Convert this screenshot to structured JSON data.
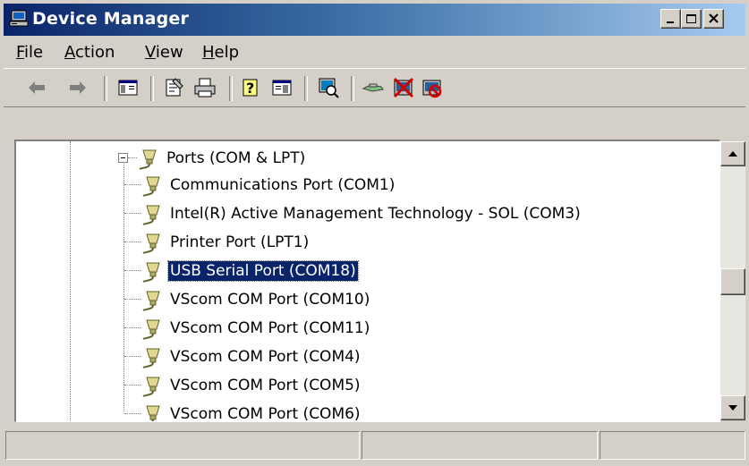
{
  "window": {
    "title": "Device Manager"
  },
  "menu": [
    {
      "label": "File",
      "mnemonic": "F",
      "rest": "ile"
    },
    {
      "label": "Action",
      "mnemonic": "A",
      "rest": "ction"
    },
    {
      "label": "View",
      "mnemonic": "V",
      "rest": "iew"
    },
    {
      "label": "Help",
      "mnemonic": "H",
      "rest": "elp"
    }
  ],
  "toolbar": {
    "buttons": [
      "back-icon",
      "forward-icon",
      "show-hide-console-tree-icon",
      "properties-icon",
      "print-icon",
      "help-icon",
      "show-action-pane-icon",
      "scan-hardware-icon",
      "update-driver-icon",
      "uninstall-icon",
      "disable-icon"
    ]
  },
  "tree": {
    "category": "Ports (COM & LPT)",
    "category_expanded": true,
    "items": [
      {
        "label": "Communications Port (COM1)"
      },
      {
        "label": "Intel(R) Active Management Technology - SOL (COM3)"
      },
      {
        "label": "Printer Port (LPT1)"
      },
      {
        "label": "USB Serial Port (COM18)",
        "selected": true
      },
      {
        "label": "VScom COM Port (COM10)"
      },
      {
        "label": "VScom COM Port (COM11)"
      },
      {
        "label": "VScom COM Port (COM4)"
      },
      {
        "label": "VScom COM Port (COM5)"
      },
      {
        "label": "VScom COM Port (COM6)"
      }
    ]
  },
  "colors": {
    "title_start": "#0a246a",
    "title_end": "#a6caf0",
    "selection": "#0a246a",
    "chrome": "#d4d0c8"
  }
}
